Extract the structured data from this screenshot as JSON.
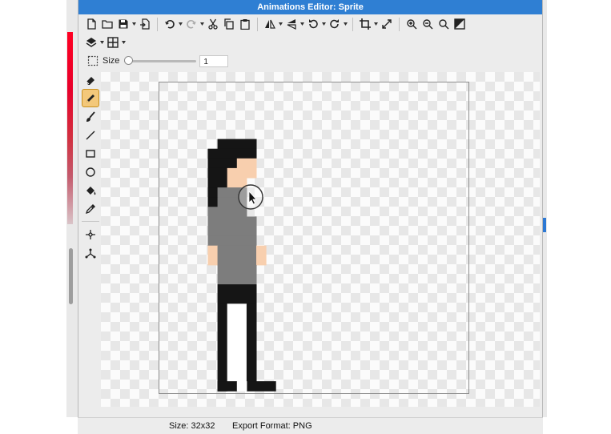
{
  "window": {
    "title": "Animations Editor: Sprite"
  },
  "toolbar_row1": [
    {
      "icon": "new-file-icon"
    },
    {
      "icon": "open-folder-icon"
    },
    {
      "icon": "save-icon",
      "caret": true
    },
    {
      "icon": "import-icon"
    },
    {
      "sep": true
    },
    {
      "icon": "undo-icon",
      "caret": true
    },
    {
      "icon": "redo-icon",
      "caret": true
    },
    {
      "icon": "cut-icon"
    },
    {
      "icon": "copy-icon"
    },
    {
      "icon": "paste-icon"
    },
    {
      "sep": true
    },
    {
      "icon": "flip-horizontal-icon",
      "caret": true
    },
    {
      "icon": "flip-vertical-icon",
      "caret": true
    },
    {
      "icon": "rotate-left-icon",
      "caret": true
    },
    {
      "icon": "rotate-right-icon",
      "caret": true
    },
    {
      "sep": true
    },
    {
      "icon": "crop-icon",
      "caret": true
    },
    {
      "icon": "resize-icon"
    },
    {
      "sep": true
    },
    {
      "icon": "zoom-in-icon"
    },
    {
      "icon": "zoom-out-icon"
    },
    {
      "icon": "zoom-actual-icon"
    },
    {
      "icon": "invert-icon"
    }
  ],
  "toolbar_row2": [
    {
      "icon": "layers-icon",
      "caret": true
    },
    {
      "icon": "grid-icon",
      "caret": true
    }
  ],
  "options": {
    "size_label": "Size",
    "size_value": "1",
    "size_slider_fraction": 0.0
  },
  "tools": [
    {
      "icon": "eraser-icon"
    },
    {
      "icon": "pencil-icon",
      "active": true
    },
    {
      "icon": "brush-icon"
    },
    {
      "icon": "line-icon"
    },
    {
      "icon": "rectangle-icon"
    },
    {
      "icon": "ellipse-icon"
    },
    {
      "icon": "fill-bucket-icon"
    },
    {
      "icon": "eyedropper-icon"
    },
    {
      "sep": true
    },
    {
      "icon": "magic-wand-icon"
    },
    {
      "icon": "pivot-icon"
    }
  ],
  "status": {
    "size": "Size: 32x32",
    "export": "Export Format: PNG"
  },
  "sprite_colors": {
    "hair": "#151515",
    "skin": "#f8cfae",
    "shirt": "#7d7d7d",
    "pants": "#151515",
    "shoe_white": "#ffffff"
  },
  "colors": {
    "title_bar": "#2f7fd3",
    "active_tool": "#f3c87a"
  }
}
